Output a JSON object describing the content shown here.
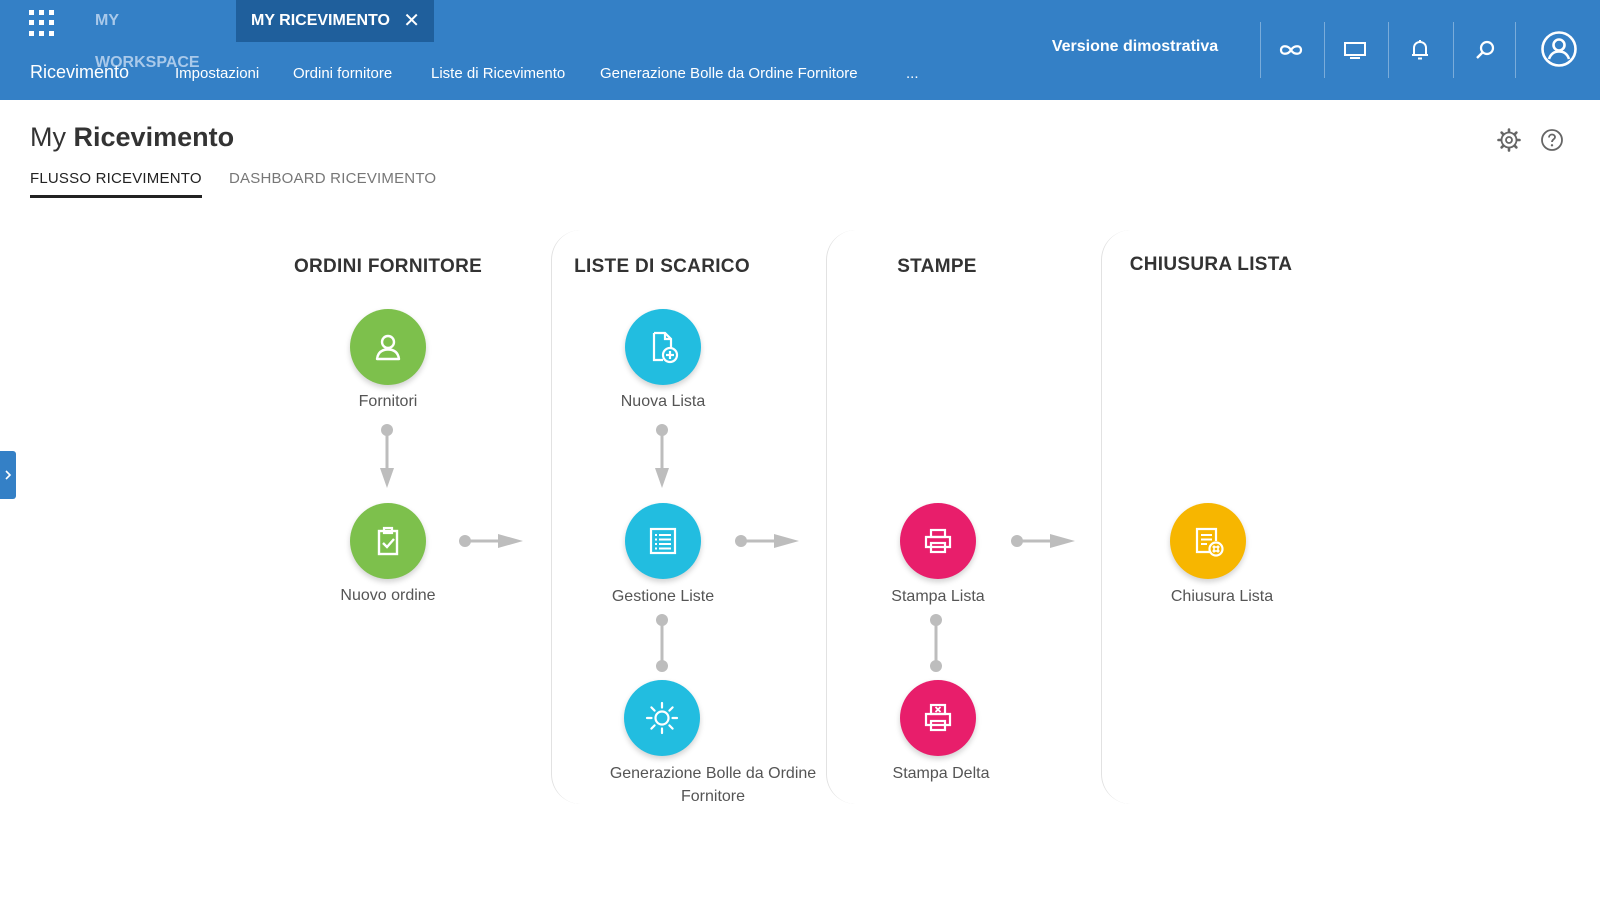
{
  "topbar": {
    "tabs": [
      {
        "label": "MY WORKSPACE"
      },
      {
        "label": "MY RICEVIMENTO",
        "close": "✕"
      }
    ],
    "title": "Ricevimento",
    "nav": [
      "Impostazioni",
      "Ordini fornitore",
      "Liste di Ricevimento",
      "Generazione Bolle da Ordine Fornitore",
      "..."
    ],
    "demo_label": "Versione dimostrativa",
    "icons": [
      "infinity-icon",
      "monitor-icon",
      "bell-icon",
      "search-icon",
      "user-account-icon"
    ]
  },
  "page": {
    "title_prefix": "My",
    "title": "Ricevimento",
    "tabs": [
      {
        "label": "FLUSSO RICEVIMENTO",
        "active": true
      },
      {
        "label": "DASHBOARD RICEVIMENTO",
        "active": false
      }
    ],
    "header_icons": [
      "gear-icon",
      "help-icon"
    ]
  },
  "flow": {
    "columns": [
      {
        "title": "ORDINI FORNITORE",
        "nodes": [
          {
            "label": "Fornitori",
            "icon": "user-icon",
            "color": "#7dc04c"
          },
          {
            "label": "Nuovo ordine",
            "icon": "clipboard-check-icon",
            "color": "#7dc04c"
          }
        ]
      },
      {
        "title": "LISTE DI SCARICO",
        "nodes": [
          {
            "label": "Nuova Lista",
            "icon": "new-document-icon",
            "color": "#22bde0"
          },
          {
            "label": "Gestione Liste",
            "icon": "list-icon",
            "color": "#22bde0"
          },
          {
            "label": "Generazione Bolle da Ordine Fornitore",
            "icon": "sun-gear-icon",
            "color": "#22bde0"
          }
        ]
      },
      {
        "title": "STAMPE",
        "nodes": [
          {
            "label": "Stampa Lista",
            "icon": "printer-icon",
            "color": "#e81e6b"
          },
          {
            "label": "Stampa Delta",
            "icon": "printer-delta-icon",
            "color": "#e81e6b"
          }
        ]
      },
      {
        "title": "CHIUSURA LISTA",
        "nodes": [
          {
            "label": "Chiusura Lista",
            "icon": "close-list-icon",
            "color": "#f7b600"
          }
        ]
      }
    ]
  }
}
